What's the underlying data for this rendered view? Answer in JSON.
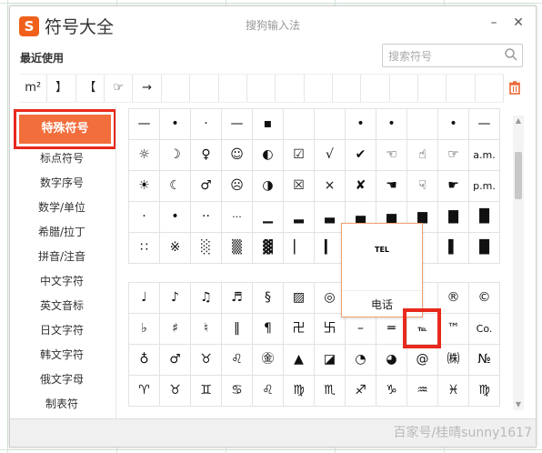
{
  "app": {
    "logo": "S",
    "name": "符号大全",
    "window_title": "搜狗输入法",
    "minimize": "–",
    "close": "✕"
  },
  "recent": {
    "label": "最近使用",
    "items": [
      "m²",
      "】",
      "【",
      "☞",
      "→",
      "",
      "",
      "",
      "",
      "",
      "",
      "",
      "",
      "",
      "",
      "",
      ""
    ]
  },
  "search": {
    "placeholder": "搜索符号",
    "icon": "search-icon"
  },
  "trash": {
    "icon": "trash-icon"
  },
  "sidebar": {
    "active": "特殊符号",
    "items": [
      "标点符号",
      "数字序号",
      "数学/单位",
      "希腊/拉丁",
      "拼音/注音",
      "中文字符",
      "英文音标",
      "日文字符",
      "韩文字符",
      "俄文字母",
      "制表符"
    ]
  },
  "grid_top": [
    [
      "—",
      "•",
      "·",
      "—",
      "▪",
      "",
      "",
      "•",
      "•",
      "",
      "•",
      "—"
    ],
    [
      "☼",
      "☽",
      "♀",
      "☺",
      "◐",
      "☑",
      "√",
      "✔",
      "☜",
      "☝",
      "☞",
      "a.m."
    ],
    [
      "☀",
      "☾",
      "♂",
      "☹",
      "◑",
      "☒",
      "×",
      "✘",
      "☚",
      "☟",
      "☛",
      "p.m."
    ],
    [
      "·",
      "•",
      "··",
      "···",
      "▁",
      "▂",
      "▃",
      "▄",
      "▅",
      "▆",
      "▇",
      "█"
    ],
    [
      "∷",
      "※",
      "░",
      "▒",
      "▓",
      "▏",
      "▎",
      "▍",
      "",
      "",
      "▌",
      "█"
    ]
  ],
  "grid_bottom": [
    [
      "♩",
      "♪",
      "♫",
      "♬",
      "§",
      "▨",
      "◎",
      "",
      "",
      "",
      "®",
      "©"
    ],
    [
      "♭",
      "♯",
      "♮",
      "‖",
      "¶",
      "卍",
      "卐",
      "–",
      "═",
      "℡",
      "™",
      "Co."
    ],
    [
      "♁",
      "♂",
      "♉",
      "♌",
      "㊎",
      "▲",
      "◪",
      "◔",
      "◕",
      "@",
      "㈱",
      "№"
    ],
    [
      "♈",
      "♉",
      "♊",
      "♋",
      "♌",
      "♍",
      "♏",
      "♐",
      "♑",
      "♒",
      "♓",
      "♍"
    ]
  ],
  "popup": {
    "symbol": "TEL",
    "name": "电话"
  },
  "watermark": "百家号/桂晴sunny1617"
}
